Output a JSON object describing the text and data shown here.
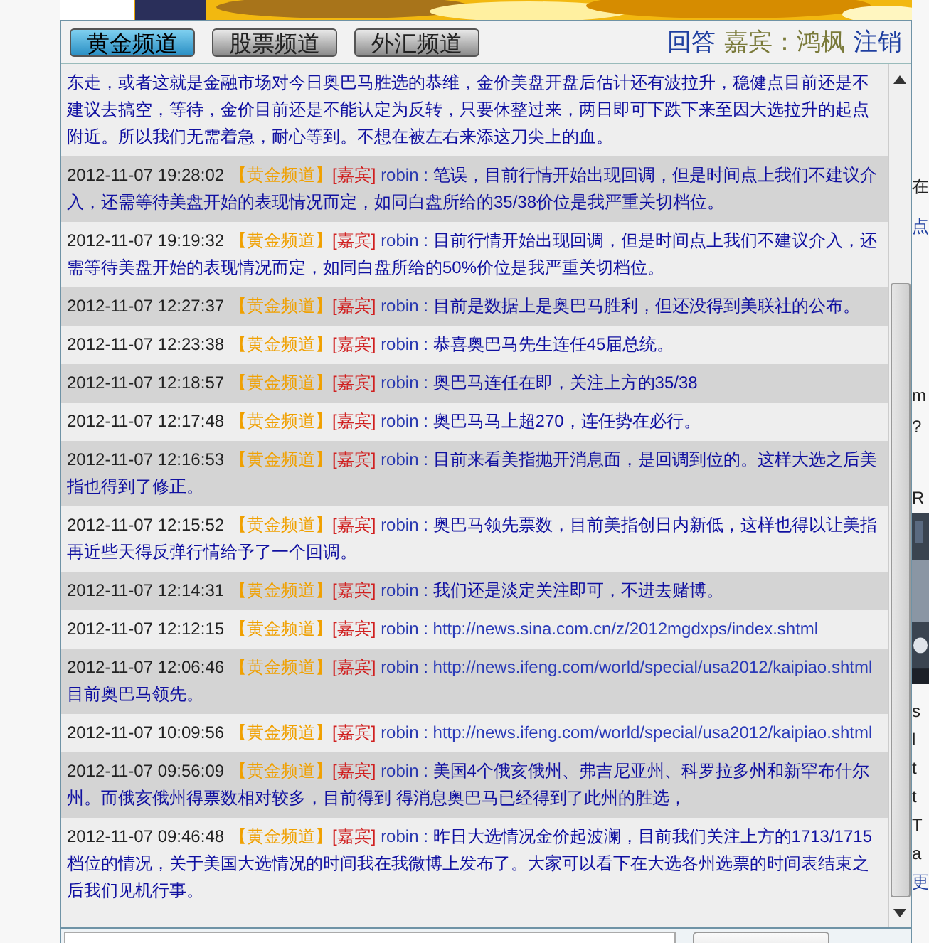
{
  "tabs": [
    {
      "label": "黄金频道",
      "selected": true
    },
    {
      "label": "股票频道",
      "selected": false
    },
    {
      "label": "外汇频道",
      "selected": false
    }
  ],
  "header_links": {
    "answer": "回答",
    "guest": "嘉宾：鸿枫",
    "logout": "注销"
  },
  "messages": [
    {
      "kind": "continuation",
      "text": "东走，或者这就是金融市场对今日奥巴马胜选的恭维，金价美盘开盘后估计还有波拉升，稳健点目前还是不建议去搞空，等待，金价目前还是不能认定为反转，只要休整过来，两日即可下跌下来至因大选拉升的起点附近。所以我们无需着急，耐心等到。不想在被左右来添这刀尖上的血。"
    },
    {
      "kind": "message",
      "time": "2012-11-07 19:28:02",
      "channel": "【黄金频道】",
      "role": "[嘉宾]",
      "user": "robin",
      "separator": ":",
      "text": "笔误，目前行情开始出现回调，但是时间点上我们不建议介入，还需等待美盘开始的表现情况而定，如同白盘所给的35/38价位是我严重关切档位。"
    },
    {
      "kind": "message",
      "time": "2012-11-07 19:19:32",
      "channel": "【黄金频道】",
      "role": "[嘉宾]",
      "user": "robin",
      "separator": ":",
      "text": "目前行情开始出现回调，但是时间点上我们不建议介入，还需等待美盘开始的表现情况而定，如同白盘所给的50%价位是我严重关切档位。"
    },
    {
      "kind": "message",
      "time": "2012-11-07 12:27:37",
      "channel": "【黄金频道】",
      "role": "[嘉宾]",
      "user": "robin",
      "separator": ":",
      "text": "目前是数据上是奥巴马胜利，但还没得到美联社的公布。"
    },
    {
      "kind": "message",
      "time": "2012-11-07 12:23:38",
      "channel": "【黄金频道】",
      "role": "[嘉宾]",
      "user": "robin",
      "separator": ":",
      "text": "恭喜奥巴马先生连任45届总统。"
    },
    {
      "kind": "message",
      "time": "2012-11-07 12:18:57",
      "channel": "【黄金频道】",
      "role": "[嘉宾]",
      "user": "robin",
      "separator": ":",
      "text": "奥巴马连任在即，关注上方的35/38"
    },
    {
      "kind": "message",
      "time": "2012-11-07 12:17:48",
      "channel": "【黄金频道】",
      "role": "[嘉宾]",
      "user": "robin",
      "separator": ":",
      "text": "奥巴马马上超270，连任势在必行。"
    },
    {
      "kind": "message",
      "time": "2012-11-07 12:16:53",
      "channel": "【黄金频道】",
      "role": "[嘉宾]",
      "user": "robin",
      "separator": ":",
      "text": "目前来看美指抛开消息面，是回调到位的。这样大选之后美指也得到了修正。"
    },
    {
      "kind": "message",
      "time": "2012-11-07 12:15:52",
      "channel": "【黄金频道】",
      "role": "[嘉宾]",
      "user": "robin",
      "separator": ":",
      "text": "奥巴马领先票数，目前美指创日内新低，这样也得以让美指再近些天得反弹行情给予了一个回调。"
    },
    {
      "kind": "message",
      "time": "2012-11-07 12:14:31",
      "channel": "【黄金频道】",
      "role": "[嘉宾]",
      "user": "robin",
      "separator": ":",
      "text": "我们还是淡定关注即可，不进去赌博。"
    },
    {
      "kind": "message",
      "time": "2012-11-07 12:12:15",
      "channel": "【黄金频道】",
      "role": "[嘉宾]",
      "user": "robin",
      "separator": ":",
      "link": "http://news.sina.com.cn/z/2012mgdxps/index.shtml"
    },
    {
      "kind": "message",
      "time": "2012-11-07 12:06:46",
      "channel": "【黄金频道】",
      "role": "[嘉宾]",
      "user": "robin",
      "separator": ":",
      "link": "http://news.ifeng.com/world/special/usa2012/kaipiao.shtml",
      "text": "目前奥巴马领先。"
    },
    {
      "kind": "message",
      "time": "2012-11-07 10:09:56",
      "channel": "【黄金频道】",
      "role": "[嘉宾]",
      "user": "robin",
      "separator": ":",
      "link": "http://news.ifeng.com/world/special/usa2012/kaipiao.shtml"
    },
    {
      "kind": "message",
      "time": "2012-11-07 09:56:09",
      "channel": "【黄金频道】",
      "role": "[嘉宾]",
      "user": "robin",
      "separator": ":",
      "text": "美国4个俄亥俄州、弗吉尼亚州、科罗拉多州和新罕布什尔州。而俄亥俄州得票数相对较多，目前得到 得消息奥巴马已经得到了此州的胜选，"
    },
    {
      "kind": "message",
      "time": "2012-11-07 09:46:48",
      "channel": "【黄金频道】",
      "role": "[嘉宾]",
      "user": "robin",
      "separator": ":",
      "text": "昨日大选情况金价起波澜，目前我们关注上方的1713/1715档位的情况，关于美国大选情况的时间我在我微博上发布了。大家可以看下在大选各州选票的时间表结束之后我们见机行事。"
    }
  ],
  "side_fragments": [
    "在",
    "点",
    "m",
    "?",
    "R",
    "s",
    "l",
    "t",
    "t",
    "T",
    "a",
    "更"
  ]
}
